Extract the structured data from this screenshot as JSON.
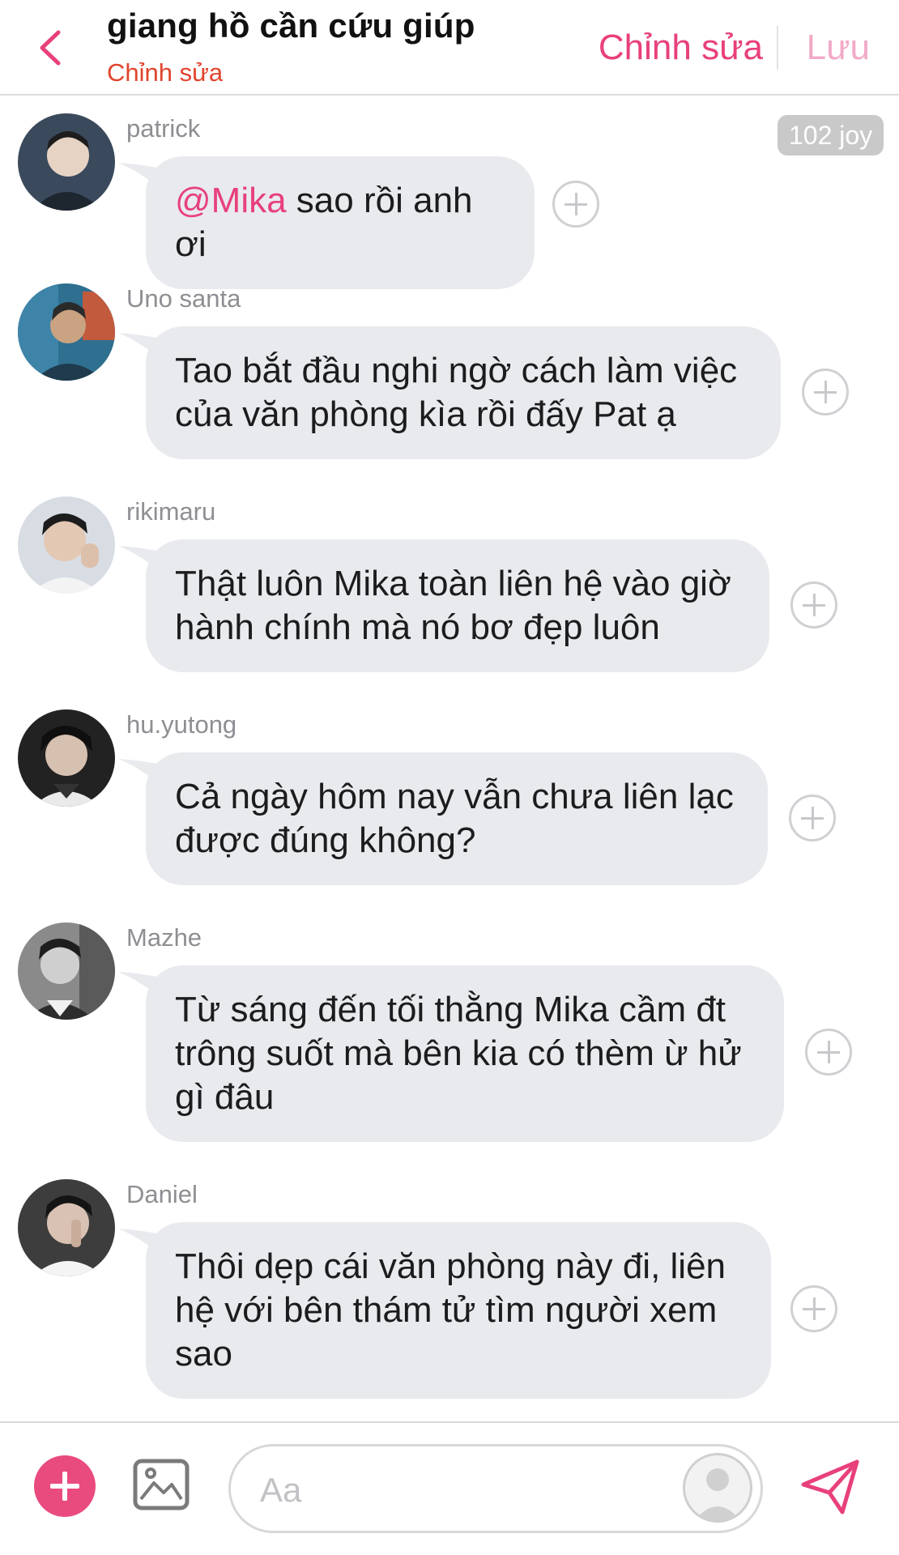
{
  "header": {
    "title": "giang hồ cần cứu giúp",
    "subtitle": "Chỉnh sửa",
    "edit_label": "Chỉnh sửa",
    "save_label": "Lưu"
  },
  "joy_badge": "102 joy",
  "messages": [
    {
      "sender": "patrick",
      "mention": "@Mika",
      "text": " sao rồi anh ơi",
      "avatar_colors": [
        "#3a4a5c",
        "#e7d3c4"
      ]
    },
    {
      "sender": "Uno santa",
      "text": "Tao bắt đầu nghi ngờ cách làm việc của văn phòng kìa rồi đấy Pat ạ",
      "avatar_colors": [
        "#2f6f8f",
        "#c9a382"
      ]
    },
    {
      "sender": "rikimaru",
      "text": "Thật luôn Mika toàn liên hệ vào giờ hành chính mà nó bơ đẹp luôn",
      "avatar_colors": [
        "#d8dde4",
        "#e3c8b4"
      ]
    },
    {
      "sender": "hu.yutong",
      "text": "Cả ngày hôm nay vẫn chưa liên lạc được đúng không?",
      "avatar_colors": [
        "#222222",
        "#d6c0b0"
      ]
    },
    {
      "sender": "Mazhe",
      "text": "Từ sáng đến tối thằng Mika cầm đt trông suốt mà bên kia có thèm ừ hử gì đâu",
      "avatar_colors": [
        "#5a5a5a",
        "#cfcfcf"
      ]
    },
    {
      "sender": "Daniel",
      "text": "Thôi dẹp cái văn phòng này đi, liên hệ với bên thám tử tìm người xem sao",
      "avatar_colors": [
        "#3d3d3d",
        "#d9c2b3"
      ]
    }
  ],
  "composer": {
    "placeholder": "Aa"
  },
  "colors": {
    "accent": "#e8407c",
    "subtitle": "#e0442c",
    "bubble": "#e8eaee"
  }
}
